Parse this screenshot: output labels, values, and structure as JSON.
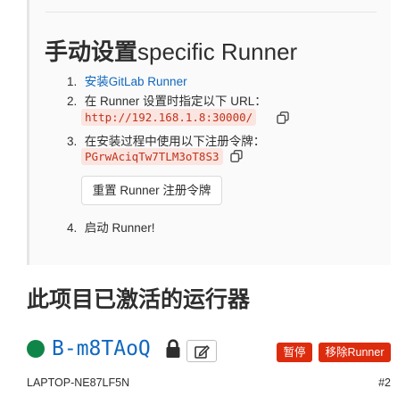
{
  "setup": {
    "title_cn": "手动设置",
    "title_en": "specific Runner",
    "steps": [
      {
        "num": "1.",
        "link": "安装GitLab Runner"
      },
      {
        "num": "2.",
        "text": "在 Runner 设置时指定以下 URL：",
        "code": "http://192.168.1.8:30000/"
      },
      {
        "num": "3.",
        "text": "在安装过程中使用以下注册令牌：",
        "code": "PGrwAciqTw7TLM3oT8S3"
      },
      {
        "num": "4.",
        "text": "启动 Runner!"
      }
    ],
    "reset_button": "重置 Runner 注册令牌"
  },
  "active": {
    "heading": "此项目已激活的运行器",
    "runner": {
      "status_color": "#108548",
      "token": "B-m8TAoQ",
      "pause_label": "暂停",
      "remove_label": "移除Runner",
      "hostname": "LAPTOP-NE87LF5N",
      "id": "#2"
    }
  },
  "icons": [
    "copy-icon",
    "lock-icon",
    "edit-icon"
  ]
}
